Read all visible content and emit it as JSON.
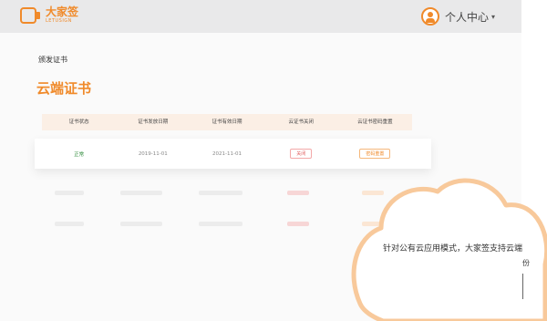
{
  "brand": {
    "name_cn": "大家签",
    "name_en": "LETUSIGN"
  },
  "header": {
    "user_label": "个人中心",
    "caret": "▾"
  },
  "breadcrumb": "颁发证书",
  "page_title": "云端证书",
  "table": {
    "columns": [
      "证书状态",
      "证书发放日期",
      "证书有效日期",
      "云证书关闭",
      "云证书密码重置"
    ],
    "row": {
      "status": "正常",
      "issue_date": "2019-11-01",
      "expire_date": "2021-11-01",
      "close_label": "关闭",
      "reset_label": "密码重置"
    }
  },
  "callout": {
    "text": "针对公有云应用模式，大家签支持云端",
    "extra": "份"
  },
  "colors": {
    "accent": "#f08a2a",
    "danger": "#e05a5a",
    "ok": "#2e8b3a"
  }
}
